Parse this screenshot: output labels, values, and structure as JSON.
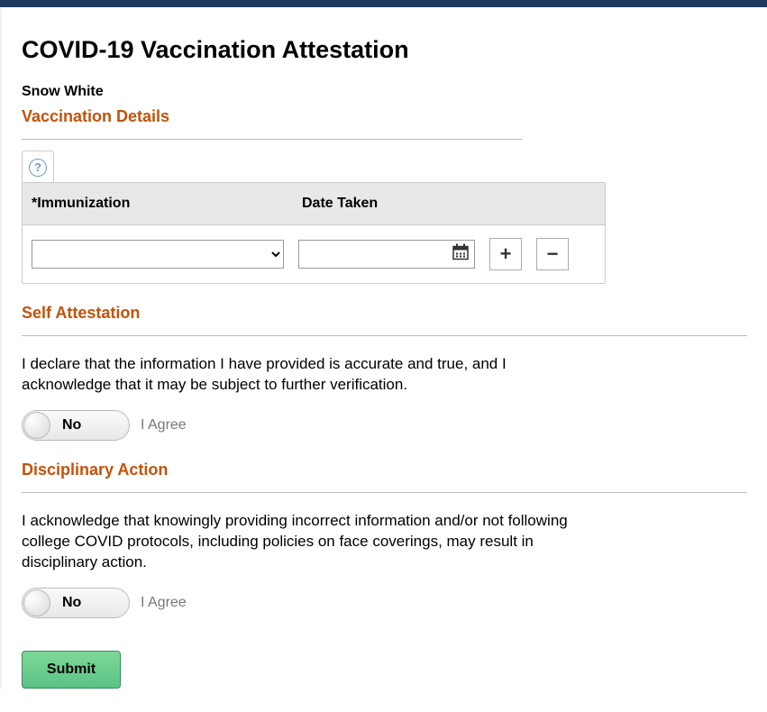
{
  "header": {
    "title": "COVID-19 Vaccination Attestation",
    "user_name": "Snow White"
  },
  "vaccination": {
    "heading": "Vaccination Details",
    "columns": {
      "immunization": "*Immunization",
      "date_taken": "Date Taken"
    },
    "row": {
      "immunization_value": "",
      "date_value": ""
    },
    "icons": {
      "help": "?",
      "add": "+",
      "remove": "−"
    }
  },
  "self_attestation": {
    "heading": "Self Attestation",
    "text": "I declare that the information I have provided is accurate and true, and I acknowledge that it may be subject to further verification.",
    "toggle_value": "No",
    "toggle_ext": "I Agree"
  },
  "disciplinary": {
    "heading": "Disciplinary Action",
    "text": "I acknowledge that knowingly providing incorrect information and/or not following college COVID protocols, including policies on face coverings, may result in disciplinary action.",
    "toggle_value": "No",
    "toggle_ext": "I Agree"
  },
  "actions": {
    "submit": "Submit"
  }
}
